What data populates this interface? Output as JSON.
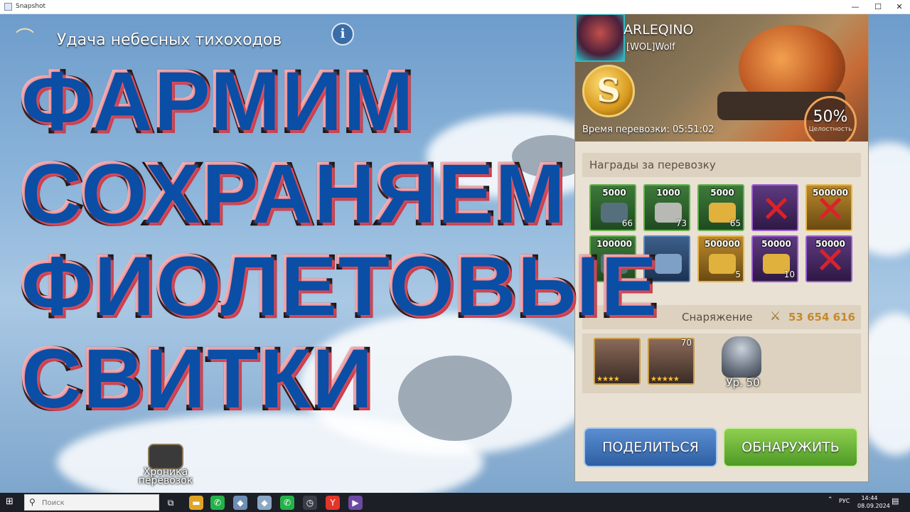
{
  "window": {
    "title": "Snapshot",
    "minimize": "—",
    "maximize": "☐",
    "close": "✕"
  },
  "event": {
    "title": "Удача небесных тихоходов",
    "info_glyph": "i"
  },
  "overlay": {
    "lines": [
      "ФАРМИМ",
      "СОХРАНЯЕМ",
      "ФИОЛЕТОВЫЕ",
      "СВИТКИ"
    ]
  },
  "chronicle": {
    "label_line1": "Хроника",
    "label_line2": "перевозок"
  },
  "panel": {
    "player_name": "ARLEQINO",
    "clan": "[WOL]Wolf",
    "grade": "S",
    "durability_percent": "50%",
    "durability_label": "Целостность",
    "transport_time": "Время перевозки: 05:51:02",
    "rewards_title": "Награды за перевозку",
    "rewards": [
      {
        "amount": "5000",
        "count": "66",
        "quality": "green",
        "item": "stone-icon",
        "excluded": false
      },
      {
        "amount": "1000",
        "count": "73",
        "quality": "green",
        "item": "ore-icon",
        "excluded": false
      },
      {
        "amount": "5000",
        "count": "65",
        "quality": "green",
        "item": "wheat-icon",
        "excluded": false
      },
      {
        "amount": "",
        "count": "",
        "quality": "purple",
        "item": "x-mark-icon",
        "excluded": true
      },
      {
        "amount": "500000",
        "count": "",
        "quality": "gold",
        "item": "x-mark-icon",
        "excluded": true
      },
      {
        "amount": "100000",
        "count": "",
        "quality": "green",
        "item": "stone-icon",
        "excluded": false
      },
      {
        "amount": "",
        "count": "",
        "quality": "blue",
        "item": "scroll-icon",
        "excluded": false
      },
      {
        "amount": "500000",
        "count": "5",
        "quality": "gold",
        "item": "wheat-icon",
        "excluded": false
      },
      {
        "amount": "50000",
        "count": "10",
        "quality": "purple",
        "item": "wheat-icon",
        "excluded": false
      },
      {
        "amount": "50000",
        "count": "",
        "quality": "purple",
        "item": "x-mark-icon",
        "excluded": true
      }
    ],
    "defense_title": "Снаряжение",
    "power_value": "53 654 616",
    "heroes": [
      {
        "stars": "★★★★",
        "level": ""
      },
      {
        "stars": "★★★★★",
        "level": "70"
      }
    ],
    "unit_level": "Ур. 50",
    "share_button": "ПОДЕЛИТЬСЯ",
    "detect_button": "ОБНАРУЖИТЬ"
  },
  "taskbar": {
    "start_glyph": "⊞",
    "search_placeholder": "Поиск",
    "search_glyph": "⚲",
    "apps": [
      {
        "name": "task-view-icon",
        "glyph": "⧉",
        "color": "#1c1f26"
      },
      {
        "name": "folder-icon",
        "glyph": "▬",
        "color": "#e0a526"
      },
      {
        "name": "whatsapp-icon",
        "glyph": "✆",
        "color": "#25b14a"
      },
      {
        "name": "game-icon-1",
        "glyph": "◆",
        "color": "#6e8fb5"
      },
      {
        "name": "game-icon-2",
        "glyph": "◆",
        "color": "#8aa8c6"
      },
      {
        "name": "whatsapp-icon-2",
        "glyph": "✆",
        "color": "#25b14a"
      },
      {
        "name": "clock-icon",
        "glyph": "◷",
        "color": "#3a3d45"
      },
      {
        "name": "yandex-icon",
        "glyph": "Y",
        "color": "#e2362a"
      },
      {
        "name": "media-icon",
        "glyph": "▶",
        "color": "#6c4aa3"
      }
    ],
    "lang": "РУС",
    "time": "14:44",
    "date": "08.09.2024",
    "chevron": "⌃",
    "notify_glyph": "▤"
  }
}
